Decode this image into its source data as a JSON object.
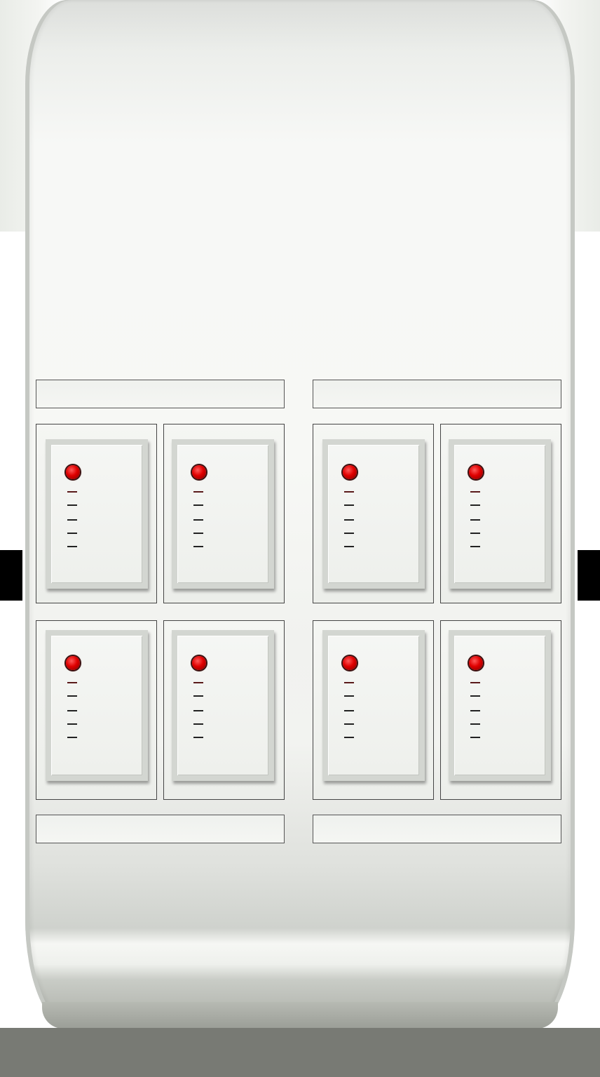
{
  "colors": {
    "panel": "#f6f7f4",
    "floor": "#787a74",
    "led_active": "#e00000",
    "tab": "#000000"
  },
  "labels": {
    "left_top": "",
    "right_top": "",
    "left_bottom": "",
    "right_bottom": ""
  },
  "modules": [
    {
      "led": "on",
      "level_ticks": 5
    },
    {
      "led": "on",
      "level_ticks": 5
    },
    {
      "led": "on",
      "level_ticks": 5
    },
    {
      "led": "on",
      "level_ticks": 5
    },
    {
      "led": "on",
      "level_ticks": 5
    },
    {
      "led": "on",
      "level_ticks": 5
    },
    {
      "led": "on",
      "level_ticks": 5
    },
    {
      "led": "on",
      "level_ticks": 5
    }
  ]
}
